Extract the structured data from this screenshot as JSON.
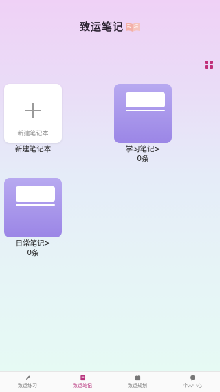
{
  "header": {
    "title": "致运笔记"
  },
  "new_notebook": {
    "label_inside": "新建笔记本",
    "caption": "新建笔记本"
  },
  "notebooks": [
    {
      "name": "学习笔记>",
      "count": "0条"
    },
    {
      "name": "日常笔记>",
      "count": "0条"
    }
  ],
  "tabs": [
    {
      "label": "致运练习",
      "icon": "pencil-icon",
      "active": false
    },
    {
      "label": "致运笔记",
      "icon": "notebook-icon",
      "active": true
    },
    {
      "label": "致运规划",
      "icon": "plan-icon",
      "active": false
    },
    {
      "label": "个人中心",
      "icon": "chat-bubble-icon",
      "active": false
    }
  ],
  "colors": {
    "accent": "#b8357e",
    "notebook": "#a795ea"
  }
}
